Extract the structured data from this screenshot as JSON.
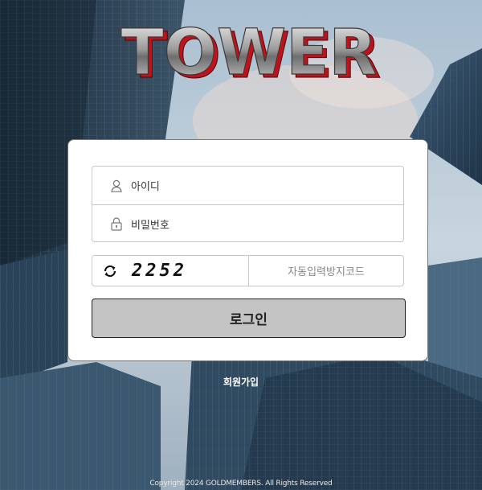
{
  "logo": {
    "text": "TOWER"
  },
  "login_form": {
    "username_placeholder": "아이디",
    "password_placeholder": "비밀번호",
    "captcha_code": "2252",
    "captcha_placeholder": "자동입력방지코드",
    "login_label": "로그인"
  },
  "signup_label": "회원가입",
  "footer": {
    "copyright": "Copyright 2024 GOLDMEMBERS. All Rights Reserved"
  },
  "icons": {
    "user": "user-icon",
    "lock": "lock-icon",
    "refresh": "refresh-icon"
  },
  "colors": {
    "button_bg": "#c4c4c4",
    "card_bg": "#ffffff",
    "logo_red": "#c0121a"
  }
}
